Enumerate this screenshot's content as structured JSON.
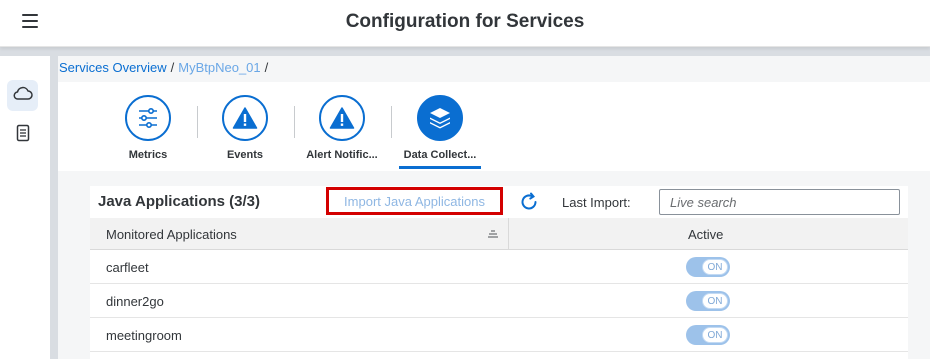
{
  "shell": {
    "title": "Configuration for Services",
    "menu_icon": "hamburger-menu-icon"
  },
  "sidenav": {
    "items": [
      {
        "icon": "cloud-icon",
        "active": true
      },
      {
        "icon": "document-icon",
        "active": false
      }
    ]
  },
  "breadcrumb": {
    "items": [
      "Services Overview",
      "MyBtpNeo_01"
    ],
    "separator": "/"
  },
  "tabs": [
    {
      "label": "Metrics",
      "icon": "sliders-icon",
      "selected": false
    },
    {
      "label": "Events",
      "icon": "warning-icon",
      "selected": false
    },
    {
      "label": "Alert Notific...",
      "icon": "warning-icon",
      "selected": false
    },
    {
      "label": "Data Collect...",
      "icon": "stack-layers-icon",
      "selected": true
    }
  ],
  "panel": {
    "title": "Java Applications (3/3)",
    "import_label": "Import Java Applications",
    "last_import_label": "Last Import:",
    "search_placeholder": "Live search"
  },
  "table": {
    "columns": [
      "Monitored Applications",
      "Active"
    ],
    "rows": [
      {
        "name": "carfleet",
        "active": "ON"
      },
      {
        "name": "dinner2go",
        "active": "ON"
      },
      {
        "name": "meetingroom",
        "active": "ON"
      }
    ]
  },
  "colors": {
    "accent": "#0a6ed1",
    "highlight_border": "#d30000",
    "toggle_on": "#9dc2ea"
  }
}
